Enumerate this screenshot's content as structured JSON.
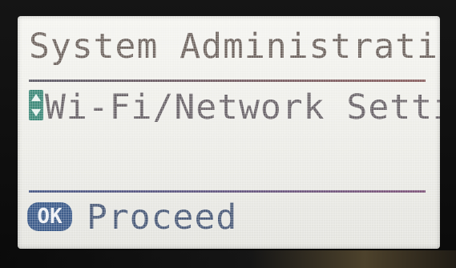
{
  "screen": {
    "title": "System Administration",
    "menu_item": {
      "label": "Wi-Fi/Network Settings",
      "scroll_icon": "up-down-arrows-icon"
    },
    "action": {
      "button_label": "OK",
      "label": "Proceed"
    }
  },
  "colors": {
    "background": "#ecece7",
    "title_text": "#6f6560",
    "menu_text": "#6a6469",
    "scroll_indicator": "#3f8a7a",
    "ok_button": "#3d5c8a",
    "action_text": "#4a5a78"
  }
}
